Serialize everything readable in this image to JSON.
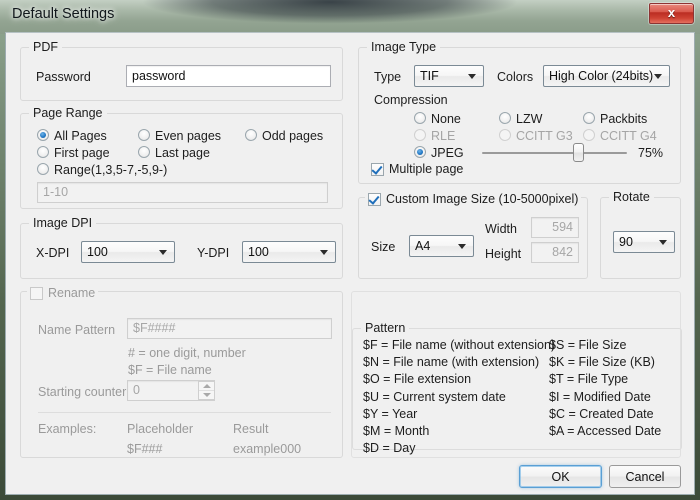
{
  "window": {
    "title": "Default Settings",
    "close_icon": "close-icon",
    "close_glyph": "x"
  },
  "pdf": {
    "legend": "PDF",
    "password_label": "Password",
    "password_value": "password"
  },
  "page_range": {
    "legend": "Page Range",
    "options": [
      {
        "label": "All Pages",
        "checked": true,
        "disabled": false
      },
      {
        "label": "Even pages",
        "checked": false,
        "disabled": false
      },
      {
        "label": "Odd pages",
        "checked": false,
        "disabled": false
      },
      {
        "label": "First page",
        "checked": false,
        "disabled": false
      },
      {
        "label": "Last page",
        "checked": false,
        "disabled": false
      },
      {
        "label": "Range(1,3,5-7,-5,9-)",
        "checked": false,
        "disabled": false
      }
    ],
    "range_value": "1-10",
    "range_disabled": true
  },
  "image_dpi": {
    "legend": "Image DPI",
    "x_label": "X-DPI",
    "x_value": "100",
    "y_label": "Y-DPI",
    "y_value": "100"
  },
  "rename": {
    "legend": "Rename",
    "checked": false,
    "name_pattern_label": "Name Pattern",
    "name_pattern_value": "$F####",
    "hint_digit": "#  = one digit, number",
    "hint_filename": "$F  = File name",
    "starting_counter_label": "Starting counter",
    "starting_counter_value": "0",
    "examples_label": "Examples:",
    "col_placeholder": "Placeholder",
    "col_result": "Result",
    "example_placeholder": "$F###",
    "example_result": "example000"
  },
  "image_type": {
    "legend": "Image Type",
    "type_label": "Type",
    "type_value": "TIF",
    "colors_label": "Colors",
    "colors_value": "High Color (24bits)",
    "compression_label": "Compression",
    "compression_options": [
      {
        "label": "None",
        "checked": false,
        "disabled": false
      },
      {
        "label": "LZW",
        "checked": false,
        "disabled": false
      },
      {
        "label": "Packbits",
        "checked": false,
        "disabled": false
      },
      {
        "label": "RLE",
        "checked": false,
        "disabled": true
      },
      {
        "label": "CCITT G3",
        "checked": false,
        "disabled": true
      },
      {
        "label": "CCITT G4",
        "checked": false,
        "disabled": true
      },
      {
        "label": "JPEG",
        "checked": true,
        "disabled": false
      }
    ],
    "quality_percent": "75%",
    "quality_value": 75,
    "multiple_page_label": "Multiple page",
    "multiple_page_checked": true
  },
  "custom_image_size": {
    "legend": "Custom Image Size (10-5000pixel)",
    "checked": true,
    "size_label": "Size",
    "size_value": "A4",
    "width_label": "Width",
    "width_value": "594",
    "height_label": "Height",
    "height_value": "842"
  },
  "rotate": {
    "legend": "Rotate",
    "value": "90"
  },
  "pattern": {
    "legend": "Pattern",
    "left_column": [
      "$F = File name (without extension)",
      "$N = File name (with extension)",
      "$O = File extension",
      "$U = Current system date",
      "$Y = Year",
      "$M = Month",
      "$D = Day"
    ],
    "right_column": [
      "$S = File Size",
      "$K = File Size (KB)",
      "$T = File Type",
      "$I  = Modified Date",
      "$C = Created Date",
      "$A = Accessed Date"
    ]
  },
  "footer": {
    "ok_label": "OK",
    "cancel_label": "Cancel"
  },
  "colors": {
    "accent_blue": "#1f76c4",
    "frame_green": "#54664f",
    "close_red": "#ba2d22",
    "dialog_bg": "#f0f0f0"
  }
}
